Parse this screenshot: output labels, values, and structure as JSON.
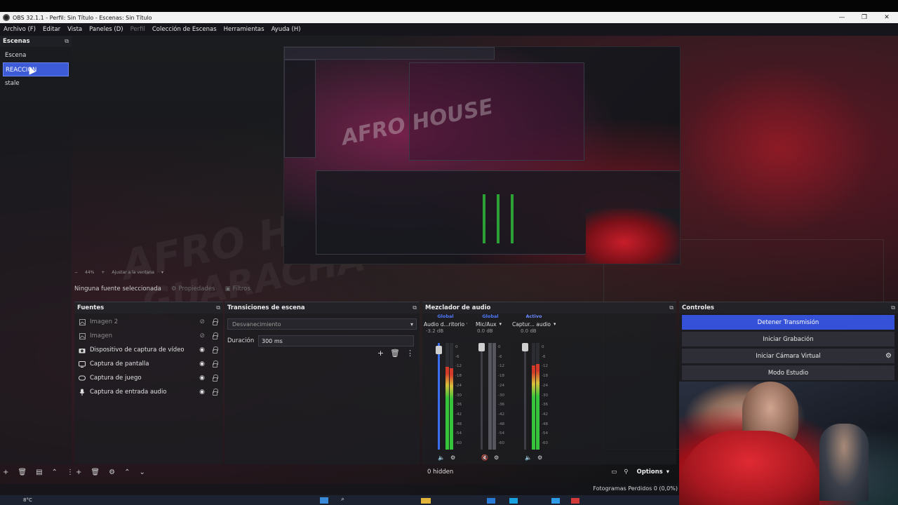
{
  "window": {
    "title": "OBS 32.1.1 - Perfil: Sin Título - Escenas: Sin Título",
    "controls": [
      "—",
      "❐",
      "✕"
    ]
  },
  "menu": [
    {
      "label": "Archivo (F)",
      "enabled": true
    },
    {
      "label": "Editar",
      "enabled": true
    },
    {
      "label": "Vista",
      "enabled": true
    },
    {
      "label": "Paneles (D)",
      "enabled": true
    },
    {
      "label": "Perfil",
      "enabled": false
    },
    {
      "label": "Colección de Escenas",
      "enabled": true
    },
    {
      "label": "Herramientas",
      "enabled": true
    },
    {
      "label": "Ayuda (H)",
      "enabled": true
    }
  ],
  "scenes": {
    "title": "Escenas",
    "items": [
      "Escena",
      "REACCION",
      "stale"
    ],
    "selected_index": 1
  },
  "preview": {
    "zoom": "44%",
    "fit_label": "Ajustar a la ventana"
  },
  "context": {
    "no_source": "Ninguna fuente seleccionada",
    "properties": "Propiedades",
    "filters": "Filtros"
  },
  "sources": {
    "title": "Fuentes",
    "items": [
      {
        "label": "Imagen 2",
        "icon": "image-icon",
        "visible": false
      },
      {
        "label": "Imagen",
        "icon": "image-icon",
        "visible": false
      },
      {
        "label": "Dispositivo de captura de vídeo",
        "icon": "camera-icon",
        "visible": true
      },
      {
        "label": "Captura de pantalla",
        "icon": "monitor-icon",
        "visible": true
      },
      {
        "label": "Captura de juego",
        "icon": "gamepad-icon",
        "visible": true
      },
      {
        "label": "Captura de entrada audio",
        "icon": "microphone-icon",
        "visible": true
      }
    ]
  },
  "transitions": {
    "title": "Transiciones de escena",
    "selected": "Desvanecimiento",
    "duration_label": "Duración",
    "duration_value": "300 ms"
  },
  "mixer": {
    "title": "Mezclador de audio",
    "channels": [
      {
        "tag": "Global",
        "name": "Audio d...ritorio",
        "db": "-3.2 dB",
        "level": 0.78,
        "fader": 0.93
      },
      {
        "tag": "Global",
        "name": "Mic/Aux",
        "db": "0.0 dB",
        "level": 0.0,
        "fader": 1.0
      },
      {
        "tag": "Activo",
        "name": "Captur... audio",
        "db": "0.0 dB",
        "level": 0.8,
        "fader": 1.0
      }
    ],
    "scale": [
      "0",
      "-6",
      "-12",
      "-18",
      "-24",
      "-30",
      "-36",
      "-42",
      "-48",
      "-54",
      "-60"
    ],
    "hidden_label": "0 hidden",
    "options_label": "Options"
  },
  "controls": {
    "title": "Controles",
    "buttons": [
      "Detener Transmisión",
      "Iniciar Grabación",
      "Iniciar Cámara Virtual",
      "Modo Estudio"
    ]
  },
  "status": {
    "frames_dropped": "Fotogramas Perdidos 0 (0,0%)"
  },
  "taskbar": {
    "weather": "8°C"
  },
  "colors": {
    "accent": "#3451d8",
    "selected_scene": "#3d5bd6",
    "mixer_tag": "#4f79ff"
  }
}
